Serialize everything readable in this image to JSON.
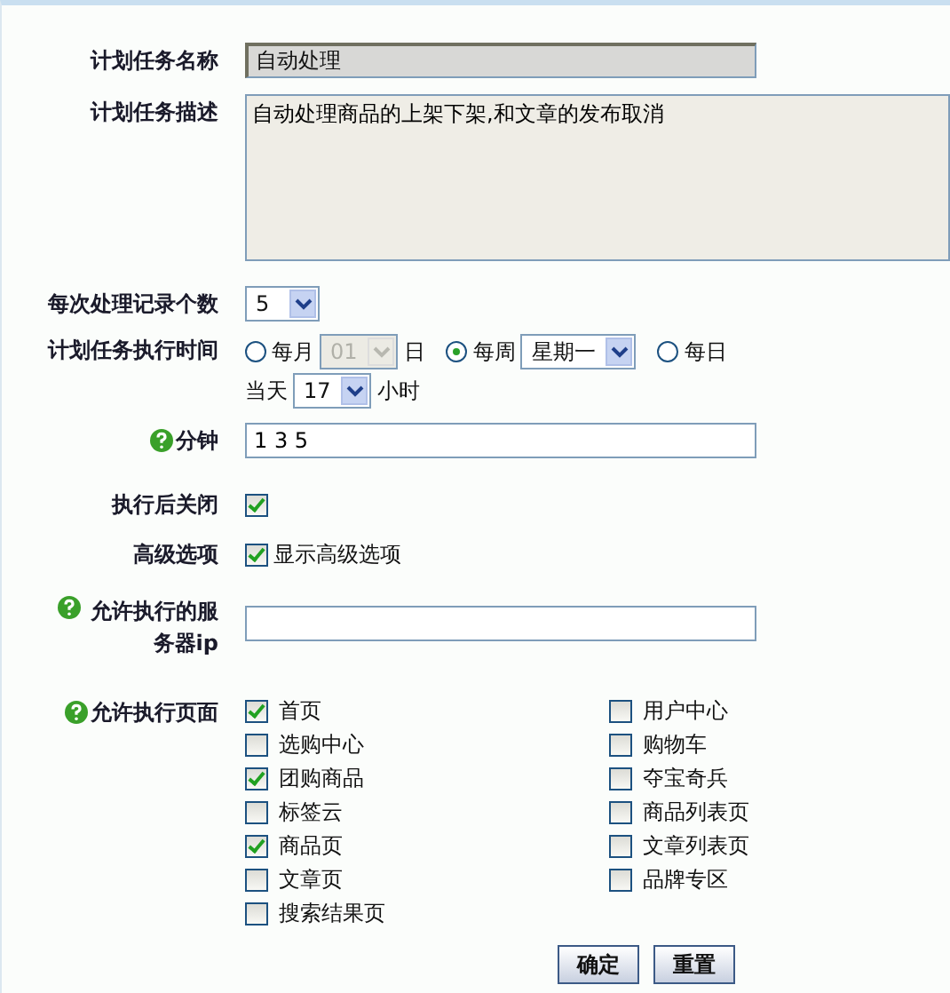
{
  "task_name": {
    "label": "计划任务名称",
    "value": "自动处理",
    "disabled": true
  },
  "task_desc": {
    "label": "计划任务描述",
    "value": "自动处理商品的上架下架,和文章的发布取消"
  },
  "record_count": {
    "label": "每次处理记录个数",
    "value": "5"
  },
  "schedule": {
    "label": "计划任务执行时间",
    "options": [
      {
        "label": "每月",
        "selected": false,
        "select": {
          "value": "01",
          "disabled": true
        },
        "suffix": "日"
      },
      {
        "label": "每周",
        "selected": true,
        "select": {
          "value": "星期一",
          "disabled": false
        }
      },
      {
        "label": "每日",
        "selected": false
      }
    ],
    "hour": {
      "prefix": "当天",
      "value": "17",
      "suffix": "小时"
    }
  },
  "minutes": {
    "label": "分钟",
    "help": true,
    "value": "1 3 5"
  },
  "close_after": {
    "label": "执行后关闭",
    "checked": true
  },
  "advanced": {
    "label": "高级选项",
    "checked": true,
    "text": "显示高级选项"
  },
  "server_ip": {
    "label": "允许执行的服务器ip",
    "help": true
  },
  "pages": {
    "label": "允许执行页面",
    "help": true,
    "columns": [
      [
        {
          "label": "首页",
          "checked": true
        },
        {
          "label": "选购中心",
          "checked": false
        },
        {
          "label": "团购商品",
          "checked": true
        },
        {
          "label": "标签云",
          "checked": false
        },
        {
          "label": "商品页",
          "checked": true
        },
        {
          "label": "文章页",
          "checked": false
        },
        {
          "label": "搜索结果页",
          "checked": false
        }
      ],
      [
        {
          "label": "用户中心",
          "checked": false
        },
        {
          "label": "购物车",
          "checked": false
        },
        {
          "label": "夺宝奇兵",
          "checked": false
        },
        {
          "label": "商品列表页",
          "checked": false
        },
        {
          "label": "文章列表页",
          "checked": false
        },
        {
          "label": "品牌专区",
          "checked": false
        }
      ]
    ]
  },
  "buttons": [
    "确定",
    "重置"
  ]
}
